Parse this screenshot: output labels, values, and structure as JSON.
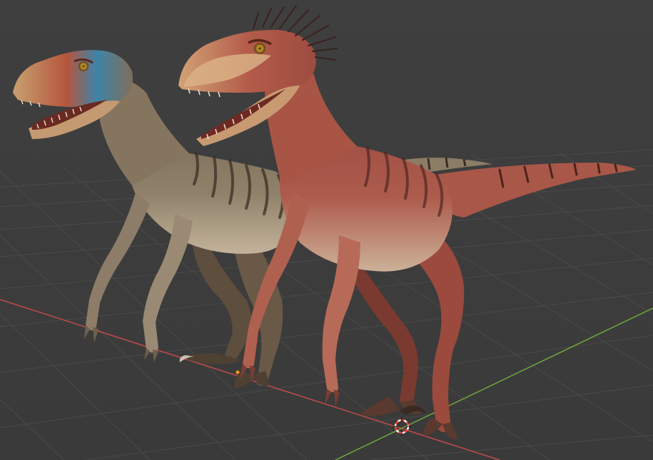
{
  "app": {
    "name": "3D viewport",
    "shading": "material-preview"
  },
  "viewport": {
    "background_color": "#3d3d3d",
    "grid_color": "#4a4a4a",
    "x_axis_color": "#c34a4a",
    "y_axis_color": "#6fa83a"
  },
  "scene": {
    "objects": [
      {
        "name": "raptor-rear",
        "kind": "velociraptor",
        "skin_color": "#8a7a63",
        "stripe_color": "#3a2f24",
        "head_highlight_color": "#3e84a8",
        "snout_color": "#c06a4c"
      },
      {
        "name": "raptor-front",
        "kind": "velociraptor",
        "skin_color": "#a9564a",
        "stripe_color": "#4a231d",
        "belly_color": "#c7a98a",
        "quill_color": "#3a2420"
      }
    ],
    "cursor": {
      "name": "3d-cursor",
      "ring_color_a": "#ff3b30",
      "ring_color_b": "#ffffff"
    },
    "origin_marker_color": "#ff9a1f"
  }
}
